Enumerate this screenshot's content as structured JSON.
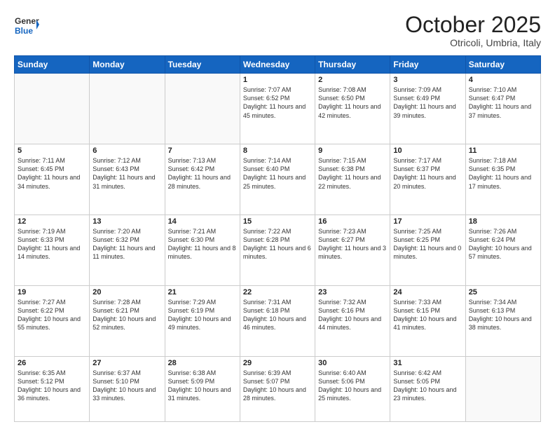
{
  "header": {
    "logo_general": "General",
    "logo_blue": "Blue",
    "month": "October 2025",
    "location": "Otricoli, Umbria, Italy"
  },
  "days_of_week": [
    "Sunday",
    "Monday",
    "Tuesday",
    "Wednesday",
    "Thursday",
    "Friday",
    "Saturday"
  ],
  "weeks": [
    [
      {
        "num": "",
        "empty": true
      },
      {
        "num": "",
        "empty": true
      },
      {
        "num": "",
        "empty": true
      },
      {
        "num": "1",
        "rise": "7:07 AM",
        "set": "6:52 PM",
        "daylight": "11 hours and 45 minutes."
      },
      {
        "num": "2",
        "rise": "7:08 AM",
        "set": "6:50 PM",
        "daylight": "11 hours and 42 minutes."
      },
      {
        "num": "3",
        "rise": "7:09 AM",
        "set": "6:49 PM",
        "daylight": "11 hours and 39 minutes."
      },
      {
        "num": "4",
        "rise": "7:10 AM",
        "set": "6:47 PM",
        "daylight": "11 hours and 37 minutes."
      }
    ],
    [
      {
        "num": "5",
        "rise": "7:11 AM",
        "set": "6:45 PM",
        "daylight": "11 hours and 34 minutes."
      },
      {
        "num": "6",
        "rise": "7:12 AM",
        "set": "6:43 PM",
        "daylight": "11 hours and 31 minutes."
      },
      {
        "num": "7",
        "rise": "7:13 AM",
        "set": "6:42 PM",
        "daylight": "11 hours and 28 minutes."
      },
      {
        "num": "8",
        "rise": "7:14 AM",
        "set": "6:40 PM",
        "daylight": "11 hours and 25 minutes."
      },
      {
        "num": "9",
        "rise": "7:15 AM",
        "set": "6:38 PM",
        "daylight": "11 hours and 22 minutes."
      },
      {
        "num": "10",
        "rise": "7:17 AM",
        "set": "6:37 PM",
        "daylight": "11 hours and 20 minutes."
      },
      {
        "num": "11",
        "rise": "7:18 AM",
        "set": "6:35 PM",
        "daylight": "11 hours and 17 minutes."
      }
    ],
    [
      {
        "num": "12",
        "rise": "7:19 AM",
        "set": "6:33 PM",
        "daylight": "11 hours and 14 minutes."
      },
      {
        "num": "13",
        "rise": "7:20 AM",
        "set": "6:32 PM",
        "daylight": "11 hours and 11 minutes."
      },
      {
        "num": "14",
        "rise": "7:21 AM",
        "set": "6:30 PM",
        "daylight": "11 hours and 8 minutes."
      },
      {
        "num": "15",
        "rise": "7:22 AM",
        "set": "6:28 PM",
        "daylight": "11 hours and 6 minutes."
      },
      {
        "num": "16",
        "rise": "7:23 AM",
        "set": "6:27 PM",
        "daylight": "11 hours and 3 minutes."
      },
      {
        "num": "17",
        "rise": "7:25 AM",
        "set": "6:25 PM",
        "daylight": "11 hours and 0 minutes."
      },
      {
        "num": "18",
        "rise": "7:26 AM",
        "set": "6:24 PM",
        "daylight": "10 hours and 57 minutes."
      }
    ],
    [
      {
        "num": "19",
        "rise": "7:27 AM",
        "set": "6:22 PM",
        "daylight": "10 hours and 55 minutes."
      },
      {
        "num": "20",
        "rise": "7:28 AM",
        "set": "6:21 PM",
        "daylight": "10 hours and 52 minutes."
      },
      {
        "num": "21",
        "rise": "7:29 AM",
        "set": "6:19 PM",
        "daylight": "10 hours and 49 minutes."
      },
      {
        "num": "22",
        "rise": "7:31 AM",
        "set": "6:18 PM",
        "daylight": "10 hours and 46 minutes."
      },
      {
        "num": "23",
        "rise": "7:32 AM",
        "set": "6:16 PM",
        "daylight": "10 hours and 44 minutes."
      },
      {
        "num": "24",
        "rise": "7:33 AM",
        "set": "6:15 PM",
        "daylight": "10 hours and 41 minutes."
      },
      {
        "num": "25",
        "rise": "7:34 AM",
        "set": "6:13 PM",
        "daylight": "10 hours and 38 minutes."
      }
    ],
    [
      {
        "num": "26",
        "rise": "6:35 AM",
        "set": "5:12 PM",
        "daylight": "10 hours and 36 minutes."
      },
      {
        "num": "27",
        "rise": "6:37 AM",
        "set": "5:10 PM",
        "daylight": "10 hours and 33 minutes."
      },
      {
        "num": "28",
        "rise": "6:38 AM",
        "set": "5:09 PM",
        "daylight": "10 hours and 31 minutes."
      },
      {
        "num": "29",
        "rise": "6:39 AM",
        "set": "5:07 PM",
        "daylight": "10 hours and 28 minutes."
      },
      {
        "num": "30",
        "rise": "6:40 AM",
        "set": "5:06 PM",
        "daylight": "10 hours and 25 minutes."
      },
      {
        "num": "31",
        "rise": "6:42 AM",
        "set": "5:05 PM",
        "daylight": "10 hours and 23 minutes."
      },
      {
        "num": "",
        "empty": true
      }
    ]
  ]
}
